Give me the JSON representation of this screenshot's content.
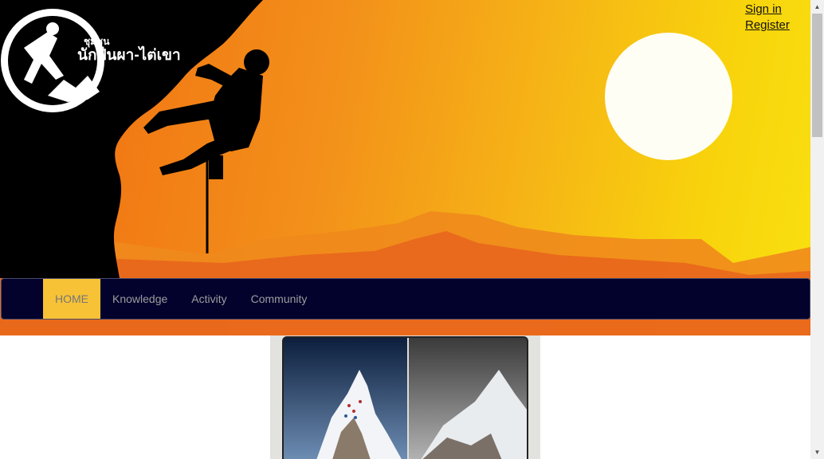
{
  "header": {
    "logo_small": "ชุมชน",
    "logo_main": "นักปีนผา-ไต่เขา",
    "signin_label": "Sign in",
    "register_label": "Register"
  },
  "nav": {
    "items": [
      {
        "label": "HOME",
        "active": true
      },
      {
        "label": "Knowledge",
        "active": false
      },
      {
        "label": "Activity",
        "active": false
      },
      {
        "label": "Community",
        "active": false
      }
    ]
  },
  "colors": {
    "nav_bg": "#02022d",
    "nav_active": "#f7c236",
    "sky_orange": "#f06a10",
    "sky_yellow": "#f9e010"
  },
  "icons": {
    "scroll_up": "▲",
    "scroll_down": "▼"
  }
}
